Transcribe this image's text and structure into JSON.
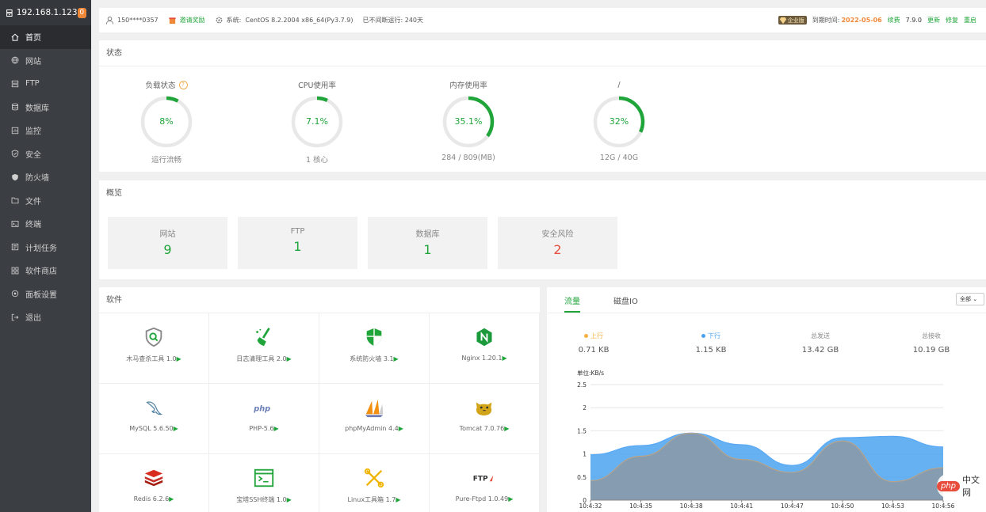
{
  "sidebar": {
    "ip": "192.168.1.123",
    "badge": "0",
    "items": [
      {
        "label": "首页",
        "icon": "home-icon"
      },
      {
        "label": "网站",
        "icon": "globe-icon"
      },
      {
        "label": "FTP",
        "icon": "ftp-icon"
      },
      {
        "label": "数据库",
        "icon": "database-icon"
      },
      {
        "label": "监控",
        "icon": "monitor-icon"
      },
      {
        "label": "安全",
        "icon": "shield-check-icon"
      },
      {
        "label": "防火墙",
        "icon": "shield-icon"
      },
      {
        "label": "文件",
        "icon": "folder-icon"
      },
      {
        "label": "终端",
        "icon": "terminal-icon"
      },
      {
        "label": "计划任务",
        "icon": "task-icon"
      },
      {
        "label": "软件商店",
        "icon": "apps-icon"
      },
      {
        "label": "面板设置",
        "icon": "settings-icon"
      },
      {
        "label": "退出",
        "icon": "logout-icon"
      }
    ]
  },
  "topbar": {
    "user": "150****0357",
    "invite": "邀请奖励",
    "system": "系统:",
    "os": "CentOS 8.2.2004 x86_64(Py3.7.9)",
    "uptime": "已不间断运行: 240天",
    "edition": "企业版",
    "expire_label": "到期时间:",
    "expire_date": "2022-05-06",
    "renew": "续费",
    "version": "7.9.0",
    "update": "更新",
    "repair": "修复",
    "restart": "重启"
  },
  "status": {
    "title": "状态",
    "gauges": [
      {
        "label": "负载状态",
        "value": "8%",
        "percent": 8,
        "sub": "运行流畅",
        "help": "?"
      },
      {
        "label": "CPU使用率",
        "value": "7.1%",
        "percent": 7.1,
        "sub": "1 核心"
      },
      {
        "label": "内存使用率",
        "value": "35.1%",
        "percent": 35.1,
        "sub": "284 / 809(MB)"
      },
      {
        "label": "/",
        "value": "32%",
        "percent": 32,
        "sub": "12G / 40G"
      }
    ]
  },
  "overview": {
    "title": "概览",
    "cards": [
      {
        "label": "网站",
        "value": "9"
      },
      {
        "label": "FTP",
        "value": "1"
      },
      {
        "label": "数据库",
        "value": "1"
      },
      {
        "label": "安全风险",
        "value": "2"
      }
    ]
  },
  "software": {
    "title": "软件",
    "items": [
      {
        "name": "木马查杀工具 1.0",
        "icon": "trojan-scan-icon"
      },
      {
        "name": "日志清理工具 2.0",
        "icon": "log-clean-icon"
      },
      {
        "name": "系统防火墙 3.1",
        "icon": "firewall-icon"
      },
      {
        "name": "Nginx 1.20.1",
        "icon": "nginx-icon"
      },
      {
        "name": "MySQL 5.6.50",
        "icon": "mysql-icon"
      },
      {
        "name": "PHP-5.6",
        "icon": "php-icon"
      },
      {
        "name": "phpMyAdmin 4.4",
        "icon": "phpmyadmin-icon"
      },
      {
        "name": "Tomcat 7.0.76",
        "icon": "tomcat-icon"
      },
      {
        "name": "Redis 6.2.6",
        "icon": "redis-icon"
      },
      {
        "name": "宝塔SSH终端 1.0",
        "icon": "ssh-terminal-icon"
      },
      {
        "name": "Linux工具箱 1.7",
        "icon": "toolbox-icon"
      },
      {
        "name": "Pure-Ftpd 1.0.49",
        "icon": "pureftpd-icon"
      }
    ],
    "arrow": "▶"
  },
  "traffic": {
    "tabs": [
      "流量",
      "磁盘IO"
    ],
    "select": "全部",
    "stats": [
      {
        "label": "上行",
        "value": "0.71 KB",
        "dot": "#f5b041"
      },
      {
        "label": "下行",
        "value": "1.15 KB",
        "dot": "#4aa3f0"
      },
      {
        "label": "总发送",
        "value": "13.42 GB"
      },
      {
        "label": "总接收",
        "value": "10.19 GB"
      }
    ]
  },
  "chart_data": {
    "type": "area",
    "ylabel": "单位:KB/s",
    "ylim": [
      0,
      2.5
    ],
    "yticks": [
      "0",
      "0.5",
      "1",
      "1.5",
      "2",
      "2.5"
    ],
    "x": [
      "10:4:32",
      "10:4:35",
      "10:4:38",
      "10:4:41",
      "10:4:47",
      "10:4:50",
      "10:4:53",
      "10:4:56"
    ],
    "series": [
      {
        "name": "上行",
        "color": "#8a9aa8",
        "values": [
          0.42,
          0.95,
          1.45,
          0.88,
          0.6,
          1.28,
          0.4,
          0.7
        ]
      },
      {
        "name": "下行",
        "color": "#4aa3f0",
        "values": [
          0.98,
          1.18,
          1.45,
          1.2,
          0.75,
          1.35,
          1.38,
          1.15
        ]
      }
    ]
  },
  "float": {
    "php": "php",
    "site": "中文网"
  }
}
